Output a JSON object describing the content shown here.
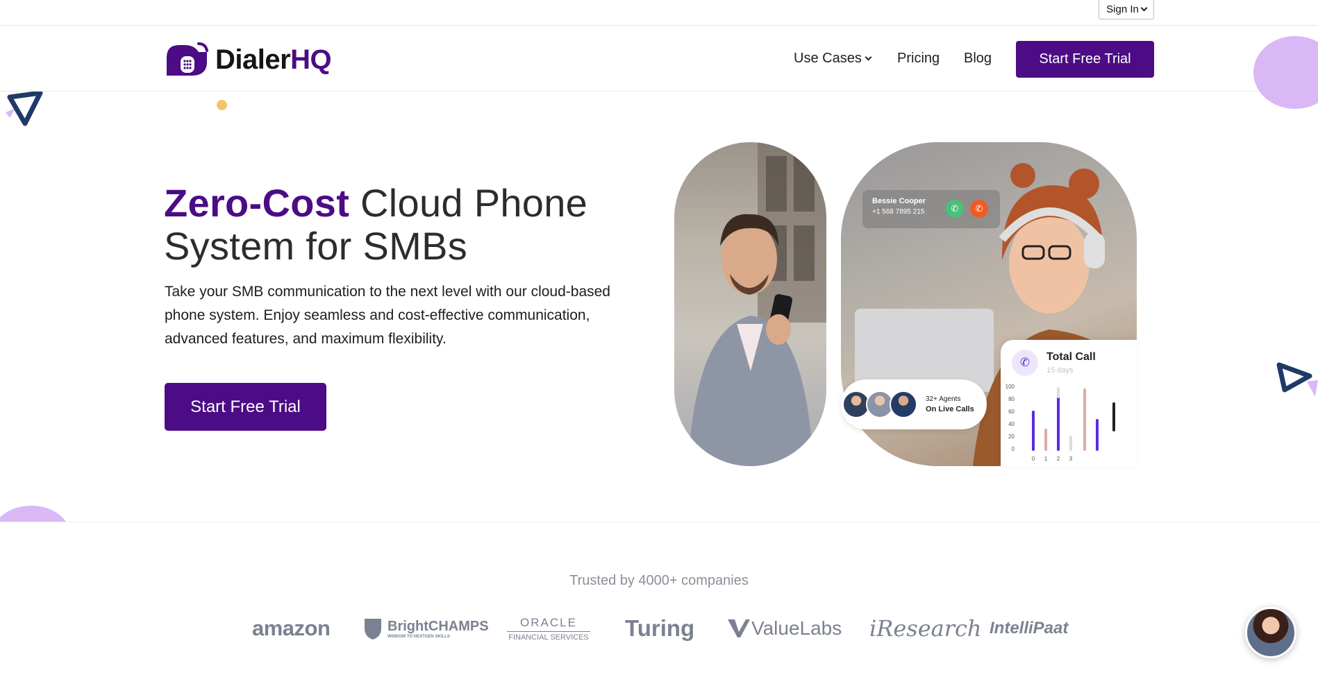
{
  "utility": {
    "sign_in_label": "Sign In"
  },
  "brand": {
    "name_main": "Dialer",
    "name_accent": "HQ"
  },
  "nav": {
    "use_cases": "Use Cases",
    "pricing": "Pricing",
    "blog": "Blog",
    "cta": "Start Free Trial"
  },
  "hero": {
    "title_accent": "Zero-Cost",
    "title_rest": " Cloud Phone System for SMBs",
    "description": "Take your SMB communication to the next level with our cloud-based phone system. Enjoy seamless and cost-effective communication, advanced features, and maximum flexibility.",
    "cta": "Start Free Trial"
  },
  "call_card": {
    "name": "Bessie Cooper",
    "number": "+1 568 7895 215"
  },
  "agents": {
    "count": "32+ Agents",
    "status": "On Live Calls"
  },
  "total_call": {
    "title": "Total Call",
    "subtitle": "15 days",
    "y_ticks": [
      "100",
      "80",
      "60",
      "40",
      "20",
      "0"
    ],
    "x_ticks": [
      "0",
      "1",
      "2",
      "3"
    ]
  },
  "trusted": {
    "title": "Trusted by 4000+ companies",
    "logos": {
      "amazon": "amazon",
      "brightchamps": "BrightCHAMPS",
      "brightchamps_tagline": "WINDOW TO NEXTGEN SKILLS",
      "oracle": "ORACLE",
      "oracle_sub": "FINANCIAL SERVICES",
      "turing": "Turing",
      "valuelabs": "ValueLabs",
      "iresearch": "iResearch",
      "intellipaat": "IntelliPaat"
    }
  },
  "colors": {
    "brand_purple": "#4b0c85",
    "accent_lilac": "#d9b8f5",
    "navy": "#1f3a66",
    "dot_orange": "#f5c26b"
  }
}
